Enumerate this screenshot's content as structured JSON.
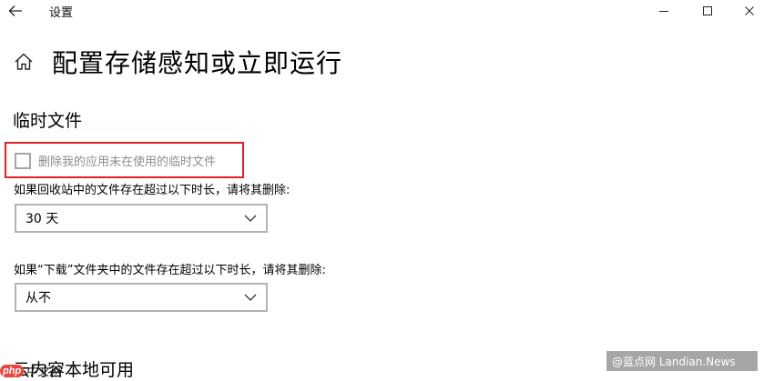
{
  "window": {
    "app_title": "设置"
  },
  "page": {
    "title": "配置存储感知或立即运行"
  },
  "temp_files": {
    "section_title": "临时文件",
    "checkbox_label": "删除我的应用未在使用的临时文件",
    "checkbox_checked": false,
    "recycle_label": "如果回收站中的文件存在超过以下时长，请将其删除:",
    "recycle_value": "30 天",
    "download_label": "如果“下载”文件夹中的文件存在超过以下时长，请将其删除:",
    "download_value": "从不"
  },
  "next_section": {
    "title": "云内容本地可用"
  },
  "watermarks": {
    "left_badge": "php",
    "left_text": "中文网",
    "right_text": "@蓝点网 Landian.News"
  },
  "colors": {
    "highlight": "#e0202a",
    "disabled_text": "#8c8c8c"
  }
}
